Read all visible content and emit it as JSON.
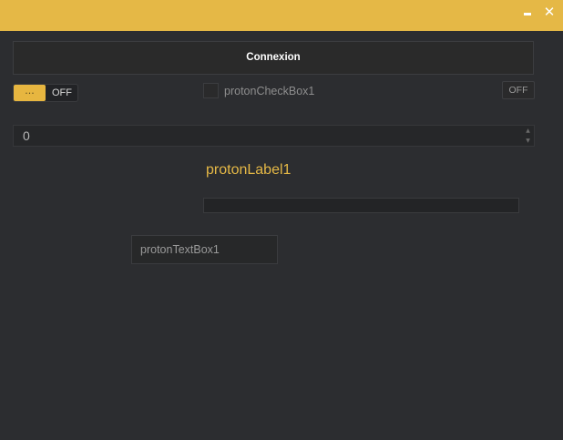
{
  "window": {
    "minimize_icon": "minimize-icon",
    "close_icon": "close-icon",
    "close_glyph": "✕",
    "accent_color": "#e5b846",
    "background_color": "#2c2d30"
  },
  "main_button": {
    "label": "Connexion"
  },
  "toggle": {
    "knob_label": "...",
    "state_label": "OFF",
    "state": "off"
  },
  "checkbox": {
    "label": "protonCheckBox1",
    "checked": false
  },
  "small_toggle": {
    "label": "OFF"
  },
  "numeric": {
    "value": "0",
    "up_glyph": "▲",
    "down_glyph": "▼"
  },
  "label1": {
    "text": "protonLabel1"
  },
  "progress": {
    "value": 0
  },
  "textbox": {
    "value": "protonTextBox1"
  }
}
